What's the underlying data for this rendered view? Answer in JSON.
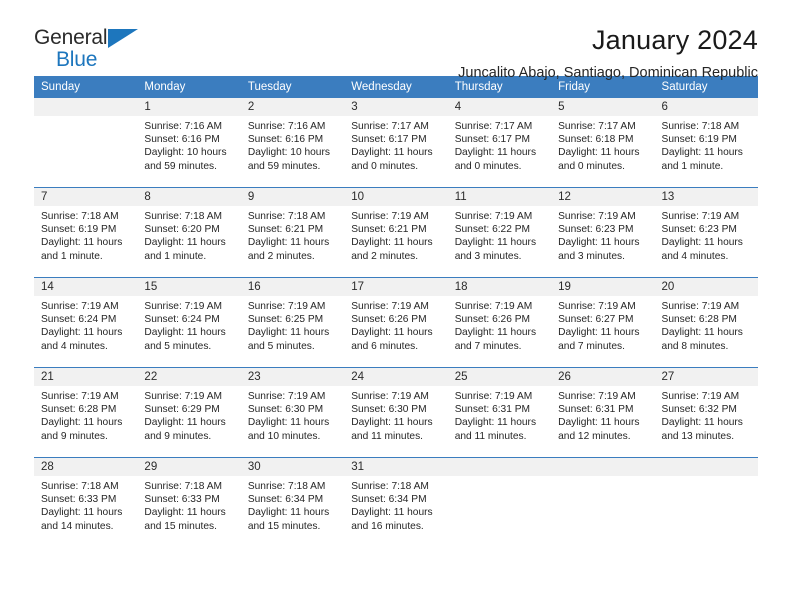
{
  "brand": {
    "name_part1": "General",
    "name_part2": "Blue",
    "accent_color": "#1d76bd"
  },
  "header": {
    "title": "January 2024",
    "subtitle": "Juncalito Abajo, Santiago, Dominican Republic",
    "header_bg_color": "#3b7dbf",
    "daynum_bg_color": "#f1f1f1"
  },
  "weekday_headers": [
    "Sunday",
    "Monday",
    "Tuesday",
    "Wednesday",
    "Thursday",
    "Friday",
    "Saturday"
  ],
  "labels": {
    "sunrise_prefix": "Sunrise:",
    "sunset_prefix": "Sunset:",
    "daylight_prefix": "Daylight:"
  },
  "weeks": [
    [
      {
        "day": "",
        "empty": true
      },
      {
        "day": "1",
        "sunrise": "Sunrise: 7:16 AM",
        "sunset": "Sunset: 6:16 PM",
        "daylight_line1": "Daylight: 10 hours",
        "daylight_line2": "and 59 minutes."
      },
      {
        "day": "2",
        "sunrise": "Sunrise: 7:16 AM",
        "sunset": "Sunset: 6:16 PM",
        "daylight_line1": "Daylight: 10 hours",
        "daylight_line2": "and 59 minutes."
      },
      {
        "day": "3",
        "sunrise": "Sunrise: 7:17 AM",
        "sunset": "Sunset: 6:17 PM",
        "daylight_line1": "Daylight: 11 hours",
        "daylight_line2": "and 0 minutes."
      },
      {
        "day": "4",
        "sunrise": "Sunrise: 7:17 AM",
        "sunset": "Sunset: 6:17 PM",
        "daylight_line1": "Daylight: 11 hours",
        "daylight_line2": "and 0 minutes."
      },
      {
        "day": "5",
        "sunrise": "Sunrise: 7:17 AM",
        "sunset": "Sunset: 6:18 PM",
        "daylight_line1": "Daylight: 11 hours",
        "daylight_line2": "and 0 minutes."
      },
      {
        "day": "6",
        "sunrise": "Sunrise: 7:18 AM",
        "sunset": "Sunset: 6:19 PM",
        "daylight_line1": "Daylight: 11 hours",
        "daylight_line2": "and 1 minute."
      }
    ],
    [
      {
        "day": "7",
        "sunrise": "Sunrise: 7:18 AM",
        "sunset": "Sunset: 6:19 PM",
        "daylight_line1": "Daylight: 11 hours",
        "daylight_line2": "and 1 minute."
      },
      {
        "day": "8",
        "sunrise": "Sunrise: 7:18 AM",
        "sunset": "Sunset: 6:20 PM",
        "daylight_line1": "Daylight: 11 hours",
        "daylight_line2": "and 1 minute."
      },
      {
        "day": "9",
        "sunrise": "Sunrise: 7:18 AM",
        "sunset": "Sunset: 6:21 PM",
        "daylight_line1": "Daylight: 11 hours",
        "daylight_line2": "and 2 minutes."
      },
      {
        "day": "10",
        "sunrise": "Sunrise: 7:19 AM",
        "sunset": "Sunset: 6:21 PM",
        "daylight_line1": "Daylight: 11 hours",
        "daylight_line2": "and 2 minutes."
      },
      {
        "day": "11",
        "sunrise": "Sunrise: 7:19 AM",
        "sunset": "Sunset: 6:22 PM",
        "daylight_line1": "Daylight: 11 hours",
        "daylight_line2": "and 3 minutes."
      },
      {
        "day": "12",
        "sunrise": "Sunrise: 7:19 AM",
        "sunset": "Sunset: 6:23 PM",
        "daylight_line1": "Daylight: 11 hours",
        "daylight_line2": "and 3 minutes."
      },
      {
        "day": "13",
        "sunrise": "Sunrise: 7:19 AM",
        "sunset": "Sunset: 6:23 PM",
        "daylight_line1": "Daylight: 11 hours",
        "daylight_line2": "and 4 minutes."
      }
    ],
    [
      {
        "day": "14",
        "sunrise": "Sunrise: 7:19 AM",
        "sunset": "Sunset: 6:24 PM",
        "daylight_line1": "Daylight: 11 hours",
        "daylight_line2": "and 4 minutes."
      },
      {
        "day": "15",
        "sunrise": "Sunrise: 7:19 AM",
        "sunset": "Sunset: 6:24 PM",
        "daylight_line1": "Daylight: 11 hours",
        "daylight_line2": "and 5 minutes."
      },
      {
        "day": "16",
        "sunrise": "Sunrise: 7:19 AM",
        "sunset": "Sunset: 6:25 PM",
        "daylight_line1": "Daylight: 11 hours",
        "daylight_line2": "and 5 minutes."
      },
      {
        "day": "17",
        "sunrise": "Sunrise: 7:19 AM",
        "sunset": "Sunset: 6:26 PM",
        "daylight_line1": "Daylight: 11 hours",
        "daylight_line2": "and 6 minutes."
      },
      {
        "day": "18",
        "sunrise": "Sunrise: 7:19 AM",
        "sunset": "Sunset: 6:26 PM",
        "daylight_line1": "Daylight: 11 hours",
        "daylight_line2": "and 7 minutes."
      },
      {
        "day": "19",
        "sunrise": "Sunrise: 7:19 AM",
        "sunset": "Sunset: 6:27 PM",
        "daylight_line1": "Daylight: 11 hours",
        "daylight_line2": "and 7 minutes."
      },
      {
        "day": "20",
        "sunrise": "Sunrise: 7:19 AM",
        "sunset": "Sunset: 6:28 PM",
        "daylight_line1": "Daylight: 11 hours",
        "daylight_line2": "and 8 minutes."
      }
    ],
    [
      {
        "day": "21",
        "sunrise": "Sunrise: 7:19 AM",
        "sunset": "Sunset: 6:28 PM",
        "daylight_line1": "Daylight: 11 hours",
        "daylight_line2": "and 9 minutes."
      },
      {
        "day": "22",
        "sunrise": "Sunrise: 7:19 AM",
        "sunset": "Sunset: 6:29 PM",
        "daylight_line1": "Daylight: 11 hours",
        "daylight_line2": "and 9 minutes."
      },
      {
        "day": "23",
        "sunrise": "Sunrise: 7:19 AM",
        "sunset": "Sunset: 6:30 PM",
        "daylight_line1": "Daylight: 11 hours",
        "daylight_line2": "and 10 minutes."
      },
      {
        "day": "24",
        "sunrise": "Sunrise: 7:19 AM",
        "sunset": "Sunset: 6:30 PM",
        "daylight_line1": "Daylight: 11 hours",
        "daylight_line2": "and 11 minutes."
      },
      {
        "day": "25",
        "sunrise": "Sunrise: 7:19 AM",
        "sunset": "Sunset: 6:31 PM",
        "daylight_line1": "Daylight: 11 hours",
        "daylight_line2": "and 11 minutes."
      },
      {
        "day": "26",
        "sunrise": "Sunrise: 7:19 AM",
        "sunset": "Sunset: 6:31 PM",
        "daylight_line1": "Daylight: 11 hours",
        "daylight_line2": "and 12 minutes."
      },
      {
        "day": "27",
        "sunrise": "Sunrise: 7:19 AM",
        "sunset": "Sunset: 6:32 PM",
        "daylight_line1": "Daylight: 11 hours",
        "daylight_line2": "and 13 minutes."
      }
    ],
    [
      {
        "day": "28",
        "sunrise": "Sunrise: 7:18 AM",
        "sunset": "Sunset: 6:33 PM",
        "daylight_line1": "Daylight: 11 hours",
        "daylight_line2": "and 14 minutes."
      },
      {
        "day": "29",
        "sunrise": "Sunrise: 7:18 AM",
        "sunset": "Sunset: 6:33 PM",
        "daylight_line1": "Daylight: 11 hours",
        "daylight_line2": "and 15 minutes."
      },
      {
        "day": "30",
        "sunrise": "Sunrise: 7:18 AM",
        "sunset": "Sunset: 6:34 PM",
        "daylight_line1": "Daylight: 11 hours",
        "daylight_line2": "and 15 minutes."
      },
      {
        "day": "31",
        "sunrise": "Sunrise: 7:18 AM",
        "sunset": "Sunset: 6:34 PM",
        "daylight_line1": "Daylight: 11 hours",
        "daylight_line2": "and 16 minutes."
      },
      {
        "day": "",
        "empty": true
      },
      {
        "day": "",
        "empty": true
      },
      {
        "day": "",
        "empty": true
      }
    ]
  ]
}
